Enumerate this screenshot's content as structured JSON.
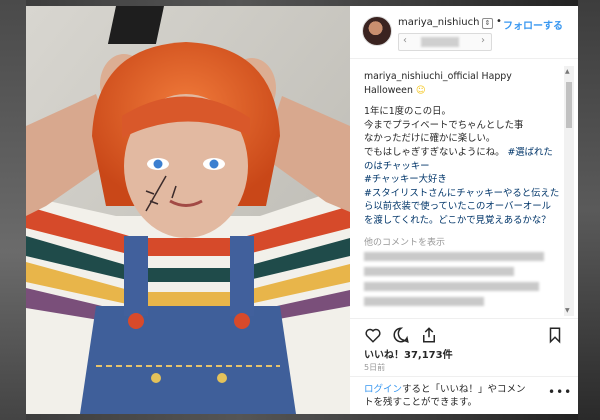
{
  "post": {
    "username": "mariya_nishiuch",
    "follow_dot": "•",
    "follow_label": "フォローする",
    "caption_user": "mariya_nishiuchi_official",
    "caption_head": "Happy Halloween",
    "caption_lines": [
      "1年に1度のこの日。",
      "今までプライベートでちゃんとした事",
      "なかっただけに確かに楽しい。",
      "でもはしゃぎすぎないようにね。"
    ],
    "tag1": "#選ばれたのはチャッキー",
    "tag2": "#チャッキー大好き",
    "tag3_line": "#スタイリストさんにチャッキーやると伝えたら以前衣装で使っていたこのオーバーオールを渡してくれた。どこかで見覚えあるかな？",
    "more_comments": "他のコメントを表示",
    "likes": "いいね！37,173件",
    "time": "5日前",
    "login_link": "ログイン",
    "login_text": "すると「いいね！」やコメントを残すことができます。"
  },
  "icons": {
    "heart": "heart-icon",
    "comment": "comment-icon",
    "share": "share-icon",
    "bookmark": "bookmark-icon",
    "options": "more-options-icon"
  },
  "colors": {
    "link": "#3897f0",
    "hashtag": "#003569",
    "hair": "#e8602a"
  }
}
